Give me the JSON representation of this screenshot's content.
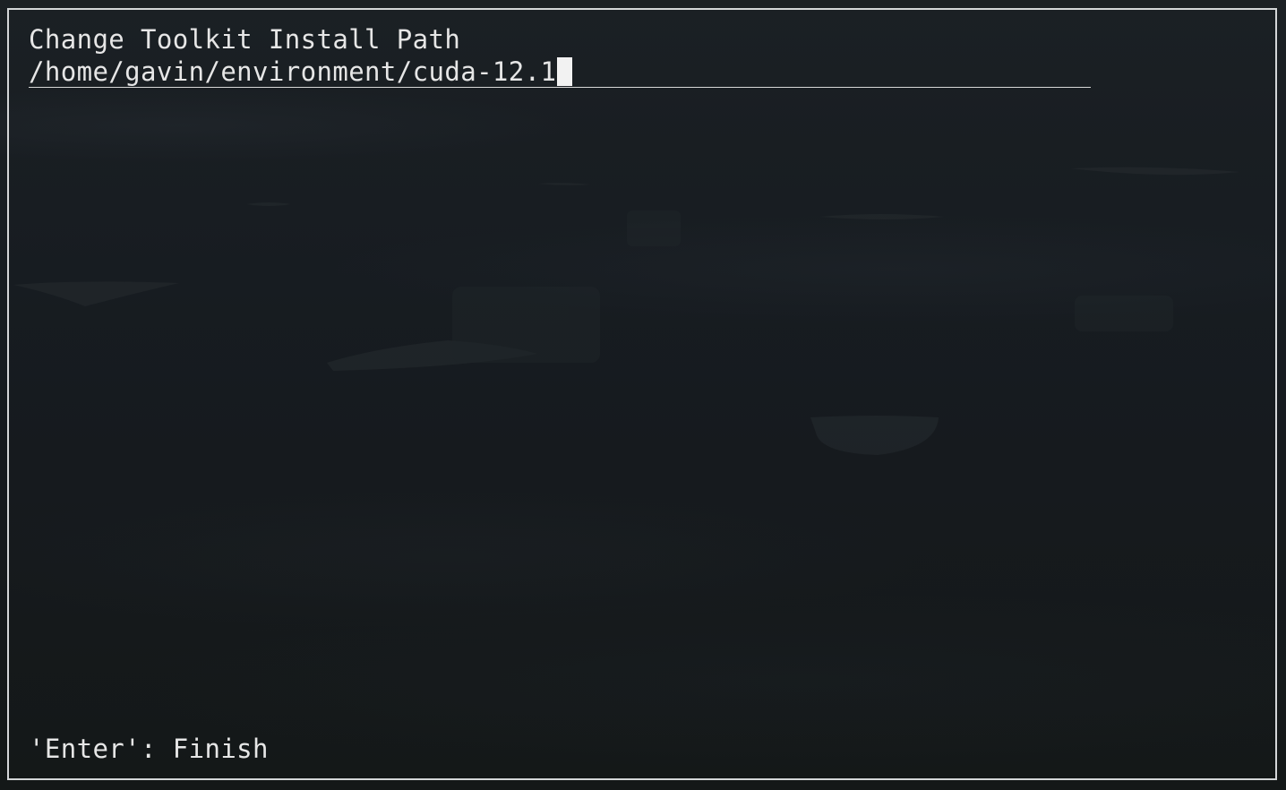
{
  "dialog": {
    "title": "Change Toolkit Install Path",
    "path_value": "/home/gavin/environment/cuda-12.1",
    "hint": "'Enter': Finish"
  },
  "colors": {
    "text": "#e6e6e6",
    "border": "#d4d6d8",
    "background": "#161b20"
  }
}
